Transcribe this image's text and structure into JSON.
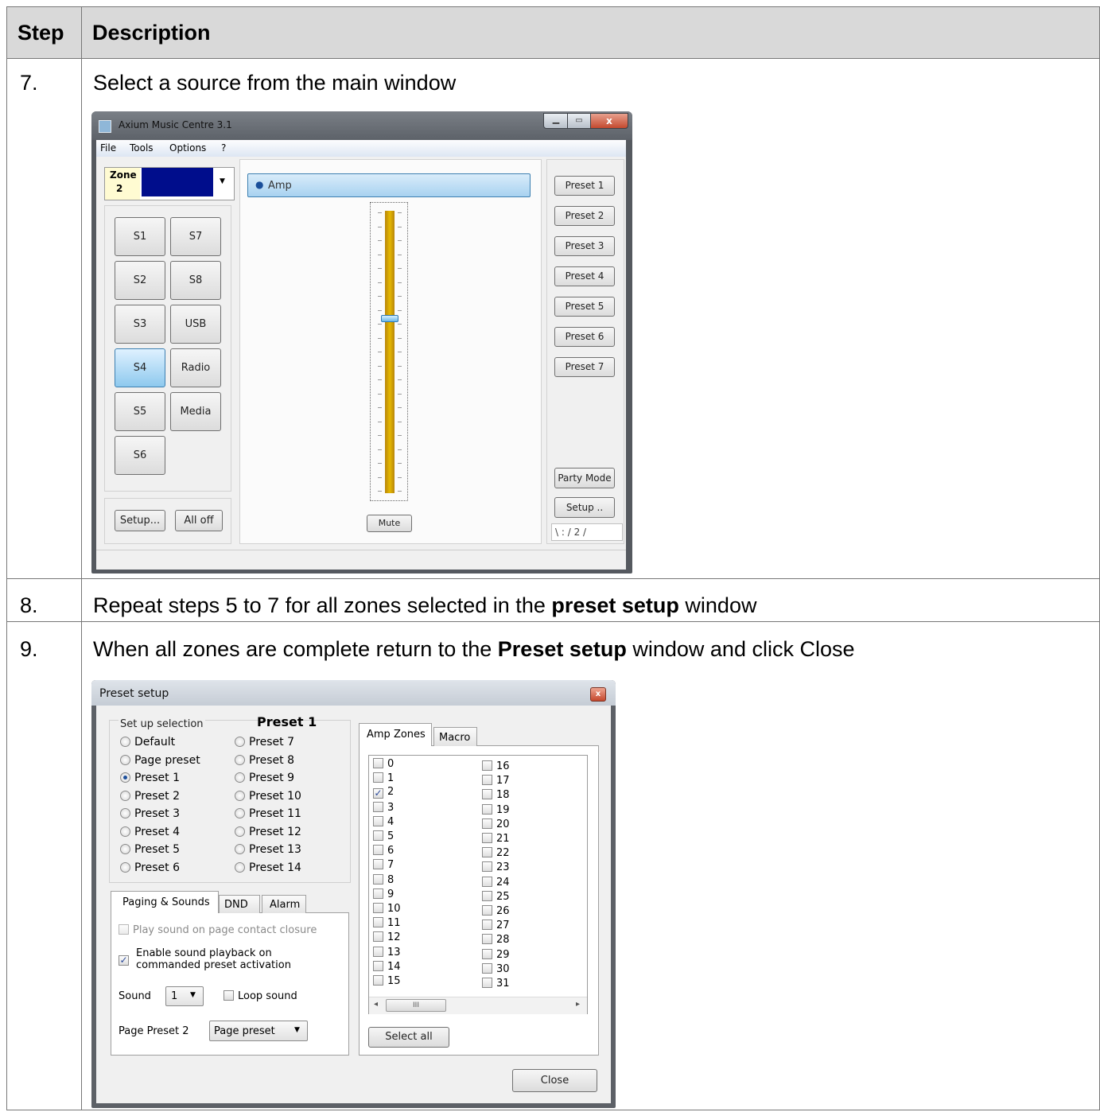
{
  "table": {
    "header_step": "Step",
    "header_description": "Description",
    "rows": [
      {
        "num": "7.",
        "text": "Select a source from the main window"
      },
      {
        "num": "8.",
        "pre": "Repeat steps 5 to 7 for all zones selected in the ",
        "bold": "preset setup",
        "post": " window"
      },
      {
        "num": "9.",
        "pre": "When all zones are complete return to the ",
        "bold": "Preset setup",
        "post": " window and click Close"
      }
    ]
  },
  "main_window": {
    "title": "Axium Music Centre 3.1",
    "menu": [
      "File",
      "Tools",
      "Options",
      "?"
    ],
    "zone_label": "Zone",
    "zone_number": "2",
    "amp_label": "Amp",
    "sources_left": [
      "S1",
      "S2",
      "S3",
      "S4",
      "S5",
      "S6"
    ],
    "sources_right": [
      "S7",
      "S8",
      "USB",
      "Radio",
      "Media"
    ],
    "selected_source": "S4",
    "presets": [
      "Preset 1",
      "Preset 2",
      "Preset 3",
      "Preset 4",
      "Preset 5",
      "Preset 6",
      "Preset 7"
    ],
    "party_mode": "Party Mode",
    "setup_right": "Setup ..",
    "setup_left": "Setup...",
    "all_off": "All off",
    "mute": "Mute",
    "volume_level": 0.62,
    "status_text": "\\ : / 2 /"
  },
  "preset_window": {
    "title": "Preset setup",
    "group_label": "Set up selection",
    "heading": "Preset 1",
    "options_left": [
      "Default",
      "Page preset",
      "Preset 1",
      "Preset 2",
      "Preset 3",
      "Preset 4",
      "Preset 5",
      "Preset 6"
    ],
    "options_right": [
      "Preset 7",
      "Preset 8",
      "Preset 9",
      "Preset 10",
      "Preset 11",
      "Preset 12",
      "Preset 13",
      "Preset 14"
    ],
    "selected_option": "Preset 1",
    "tabs_lower": [
      "Paging & Sounds",
      "DND",
      "Alarm"
    ],
    "play_sound": "Play sound on page contact closure",
    "enable_line1": "Enable sound playback on",
    "enable_line2": "commanded preset activation",
    "sound_label": "Sound",
    "sound_value": "1",
    "loop_sound": "Loop sound",
    "page_preset_label": "Page Preset 2",
    "page_preset_value": "Page preset",
    "tabs_right": [
      "Amp Zones",
      "Macro"
    ],
    "zones_col1": [
      "0",
      "1",
      "2",
      "3",
      "4",
      "5",
      "6",
      "7",
      "8",
      "9",
      "10",
      "11",
      "12",
      "13",
      "14",
      "15"
    ],
    "zones_col2": [
      "16",
      "17",
      "18",
      "19",
      "20",
      "21",
      "22",
      "23",
      "24",
      "25",
      "26",
      "27",
      "28",
      "29",
      "30",
      "31"
    ],
    "checked_zone": "2",
    "scroll_mark": "III",
    "select_all": "Select all",
    "close": "Close"
  }
}
